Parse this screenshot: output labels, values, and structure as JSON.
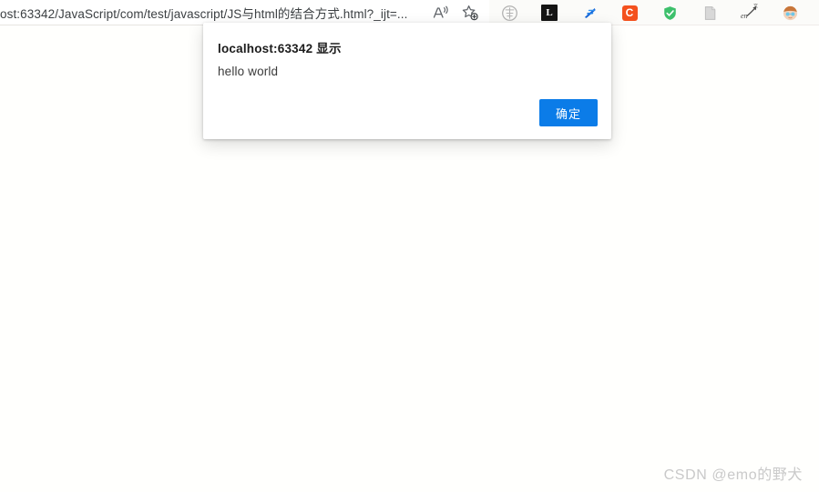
{
  "browser": {
    "address": {
      "url_text": "ost:63342/JavaScript/com/test/javascript/JS与html的结合方式.html?_ijt=...",
      "read_aloud_icon": "read-aloud-icon",
      "favorite_icon": "add-favorite-star-icon"
    },
    "extensions": [
      {
        "name": "grey-circle-extension-icon",
        "label": ""
      },
      {
        "name": "dark-square-extension-icon",
        "label": "L"
      },
      {
        "name": "blue-e-extension-icon",
        "label": ""
      },
      {
        "name": "orange-c-extension-icon",
        "label": "C"
      },
      {
        "name": "green-shield-extension-icon",
        "label": ""
      },
      {
        "name": "grey-page-extension-icon",
        "label": ""
      },
      {
        "name": "translate-en-extension-icon",
        "label": "en"
      },
      {
        "name": "profile-avatar-icon",
        "label": ""
      }
    ]
  },
  "dialog": {
    "title": "localhost:63342 显示",
    "message": "hello world",
    "confirm_label": "确定",
    "accent_color": "#0b7ce8"
  },
  "watermark": {
    "text": "CSDN @emo的野犬"
  }
}
